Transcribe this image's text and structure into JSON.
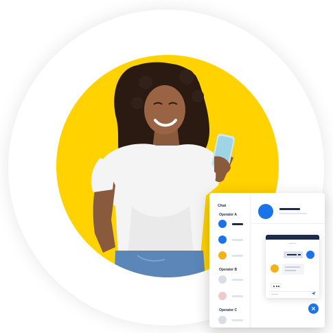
{
  "colors": {
    "accent_yellow": "#ffd200",
    "navy": "#1b2b4b",
    "brand_blue": "#1a73e8",
    "shirt_white": "#f4f4f4",
    "jeans_blue": "#5b86b8"
  },
  "chat_widget": {
    "title": "Chat",
    "groups": [
      {
        "label": "Operator A"
      },
      {
        "label": "Operator B"
      },
      {
        "label": "Operator C"
      }
    ]
  },
  "icons": {
    "send": "send-icon",
    "close": "close-icon",
    "typing": "typing-indicator-icon"
  }
}
